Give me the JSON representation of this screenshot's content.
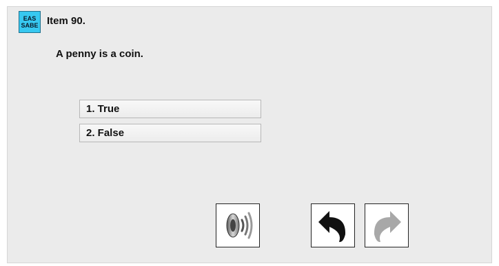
{
  "badge": {
    "line1": "EAS",
    "line2": "SABE",
    "color": "#37c8f0"
  },
  "item": {
    "label": "Item 90."
  },
  "question": {
    "text": "A penny is a coin."
  },
  "options": [
    {
      "label": "1. True"
    },
    {
      "label": "2. False"
    }
  ],
  "controls": {
    "audio": {
      "icon": "speaker-icon"
    },
    "back": {
      "icon": "back-arrow-icon",
      "enabled": true
    },
    "forward": {
      "icon": "forward-arrow-icon",
      "enabled": false
    }
  }
}
